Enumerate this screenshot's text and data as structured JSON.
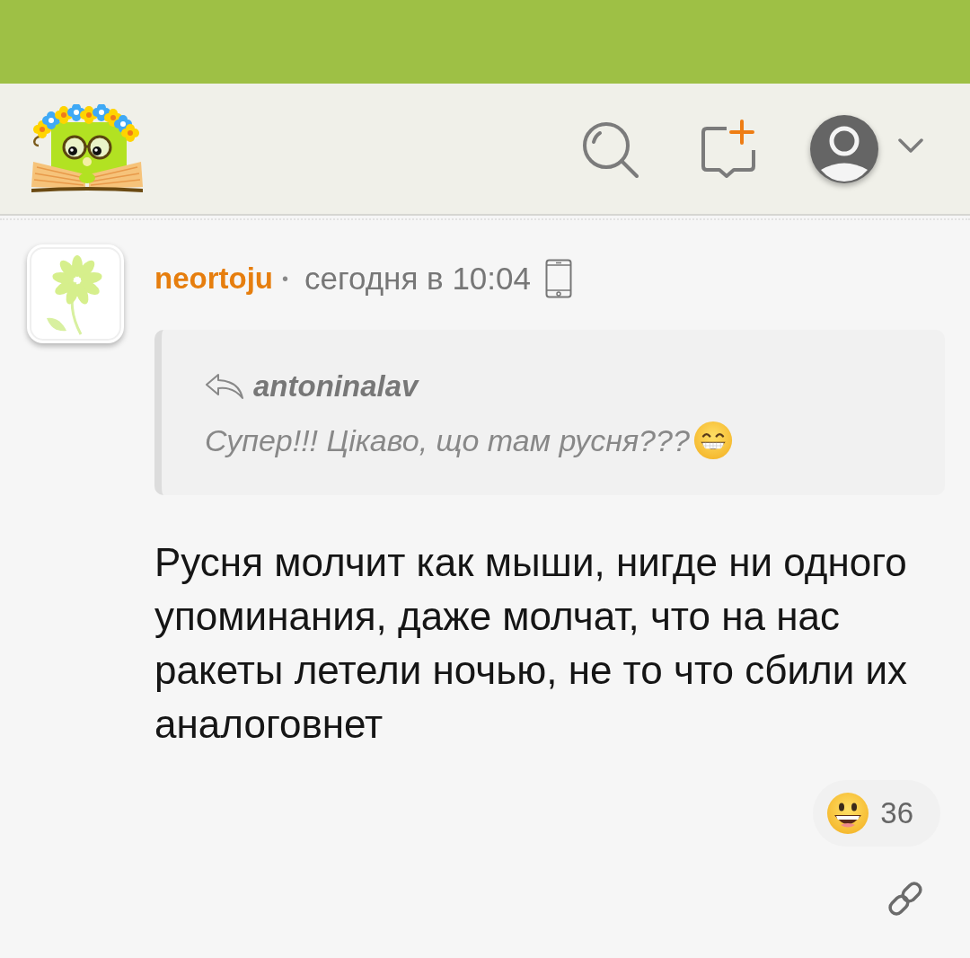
{
  "comment": {
    "author": "neortoju",
    "separator": "•",
    "time": "сегодня в 10:04",
    "quote": {
      "author": "antoninalav",
      "text": "Супер!!! Цікаво, що там русня???"
    },
    "text": "Русня молчит как мыши, нигде ни одного упоминания, даже молчат, что на нас ракеты летели ночью, не то что сбили их аналоговнет",
    "reactions": [
      {
        "count": "36"
      }
    ]
  }
}
